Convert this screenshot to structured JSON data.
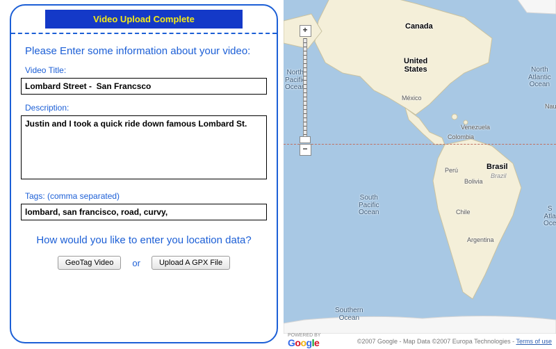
{
  "banner": {
    "text": "Video Upload Complete"
  },
  "form": {
    "heading": "Please Enter some information about your video:",
    "title_label": "Video Title:",
    "title_value": "Lombard Street -  San Francsco",
    "description_label": "Description:",
    "description_value": "Justin and I took a quick ride down famous Lombard St.",
    "tags_label": "Tags: (comma separated)",
    "tags_value": "lombard, san francisco, road, curvy,",
    "location_heading": "How would you like to enter you location data?",
    "geotag_button": "GeoTag Video",
    "or_text": "or",
    "gpx_button": "Upload A GPX File"
  },
  "map": {
    "zoom_in": "+",
    "zoom_out": "−",
    "labels": {
      "canada": "Canada",
      "united_states": "United\nStates",
      "mexico": "México",
      "venezuela": "Venezuela",
      "colombia": "Colombia",
      "peru": "Perú",
      "bolivia": "Bolivia",
      "brasil": "Brasil",
      "brasil_it": "Brazil",
      "chile": "Chile",
      "argentina": "Argentina",
      "north_pacific": "North\nPacific\nOcean",
      "south_pacific": "South\nPacific\nOcean",
      "north_atlantic": "North\nAtlantic\nOcean",
      "south_atlantic": "S\nAtla\nOce",
      "southern_ocean": "Southern\nOcean",
      "naur": "Nau"
    },
    "footer": {
      "powered": "POWERED BY",
      "brand": "Google",
      "copyright": "©2007 Google - Map Data ©2007 Europa Technologies -",
      "terms": "Terms of use"
    }
  }
}
